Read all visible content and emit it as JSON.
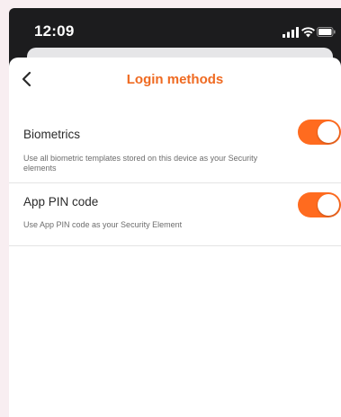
{
  "status_bar": {
    "time": "12:09",
    "icons": [
      "signal-icon",
      "wifi-icon",
      "battery-icon"
    ]
  },
  "nav": {
    "back_icon": "chevron-left-icon",
    "title": "Login methods"
  },
  "settings": [
    {
      "label": "Biometrics",
      "description": "Use all biometric templates stored on this device as your Security elements",
      "enabled": true
    },
    {
      "label": "App PIN code",
      "description": "Use App PIN code as your Security Element",
      "enabled": true
    }
  ],
  "colors": {
    "accent": "#ff6b1f",
    "title": "#ef6a21",
    "page_background": "#f8eef1",
    "phone_background": "#1c1c1e"
  }
}
